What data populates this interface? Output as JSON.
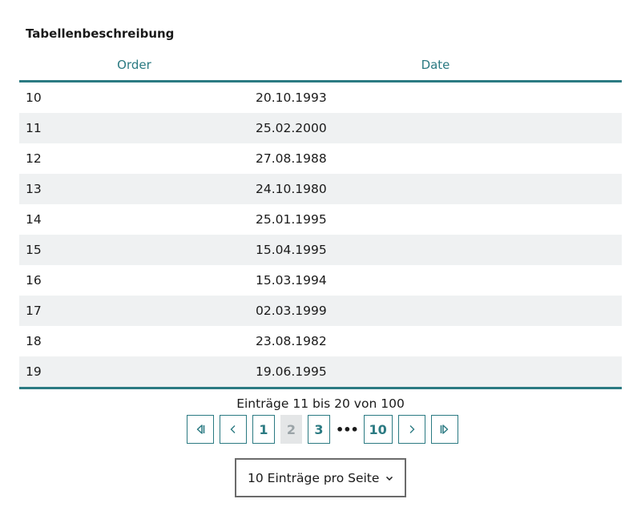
{
  "table": {
    "caption": "Tabellenbeschreibung",
    "columns": [
      "Order",
      "Date"
    ],
    "rows": [
      [
        "10",
        "20.10.1993"
      ],
      [
        "11",
        "25.02.2000"
      ],
      [
        "12",
        "27.08.1988"
      ],
      [
        "13",
        "24.10.1980"
      ],
      [
        "14",
        "25.01.1995"
      ],
      [
        "15",
        "15.04.1995"
      ],
      [
        "16",
        "15.03.1994"
      ],
      [
        "17",
        "02.03.1999"
      ],
      [
        "18",
        "23.08.1982"
      ],
      [
        "19",
        "19.06.1995"
      ]
    ]
  },
  "pagination": {
    "info": "Einträge 11 bis 20 von 100",
    "pages": [
      "1",
      "2",
      "3",
      "10"
    ],
    "current_page": "2",
    "ellipsis": "•••"
  },
  "page_size": {
    "selected": "10 Einträge pro Seite"
  },
  "colors": {
    "accent": "#2b7a82",
    "row_alt": "#eff1f2"
  }
}
